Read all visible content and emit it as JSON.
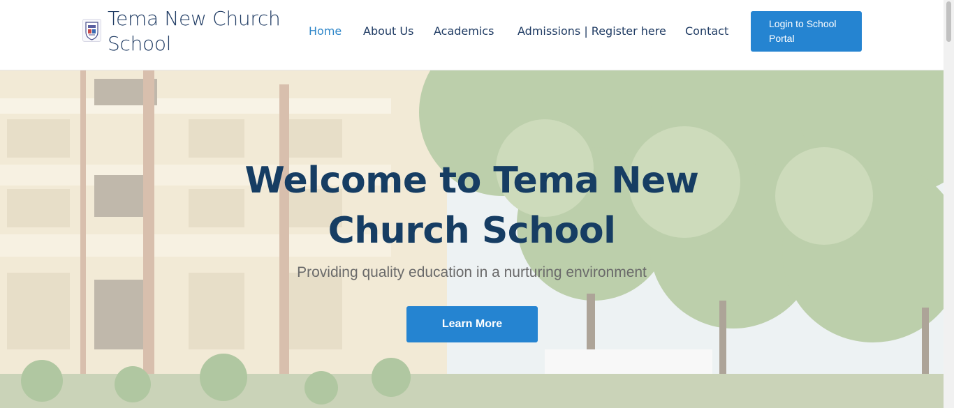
{
  "header": {
    "brand_line1": "Tema New Church",
    "brand_line2": "School",
    "nav": [
      {
        "label": "Home"
      },
      {
        "label": "About Us"
      },
      {
        "label": "Academics"
      },
      {
        "label": "Admissions | Register here"
      },
      {
        "label": "Contact"
      }
    ],
    "login_line1": "Login to School",
    "login_line2": "Portal"
  },
  "hero": {
    "title_line1": "Welcome to Tema New",
    "title_line2": "Church School",
    "subtitle": "Providing quality education in a nurturing environment",
    "button_label": "Learn More"
  },
  "colors": {
    "brand_navy": "#1f3b63",
    "active_link": "#2e86c9",
    "button_blue": "#2584d1",
    "hero_title": "#163d63"
  },
  "icons": {
    "logo": "school-crest-icon"
  }
}
